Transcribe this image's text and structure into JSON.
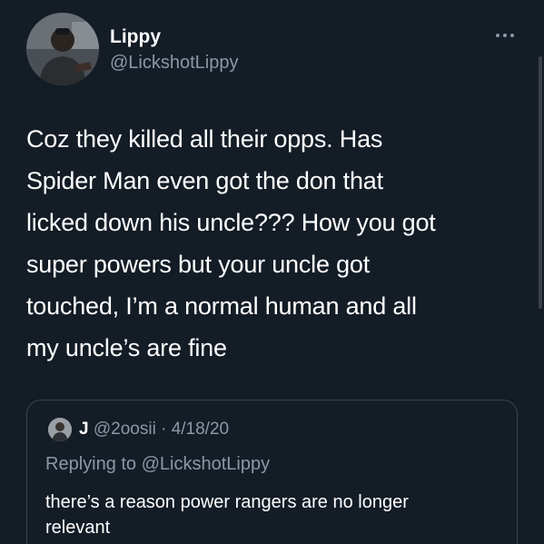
{
  "author": {
    "display_name": "Lippy",
    "handle": "@LickshotLippy",
    "avatar_icon": "user-photo-avatar"
  },
  "more_icon": "ellipsis-icon",
  "tweet": {
    "lines": [
      "Coz they killed all their opps. Has",
      "Spider Man even got the don that",
      "licked down his uncle??? How you got",
      "super powers but your uncle got",
      "touched, I’m a normal human and all",
      "my uncle’s are fine"
    ]
  },
  "quoted": {
    "name": "J",
    "handle": "@2oosii",
    "separator": "·",
    "date": "4/18/20",
    "replying_prefix": "Replying to",
    "replying_mention": "@LickshotLippy",
    "lines": [
      "there’s a reason power rangers are no longer",
      "relevant"
    ]
  },
  "colors": {
    "background": "#141c26",
    "text": "#ffffff",
    "secondary_text": "#8b98a5",
    "border": "#38444d"
  }
}
